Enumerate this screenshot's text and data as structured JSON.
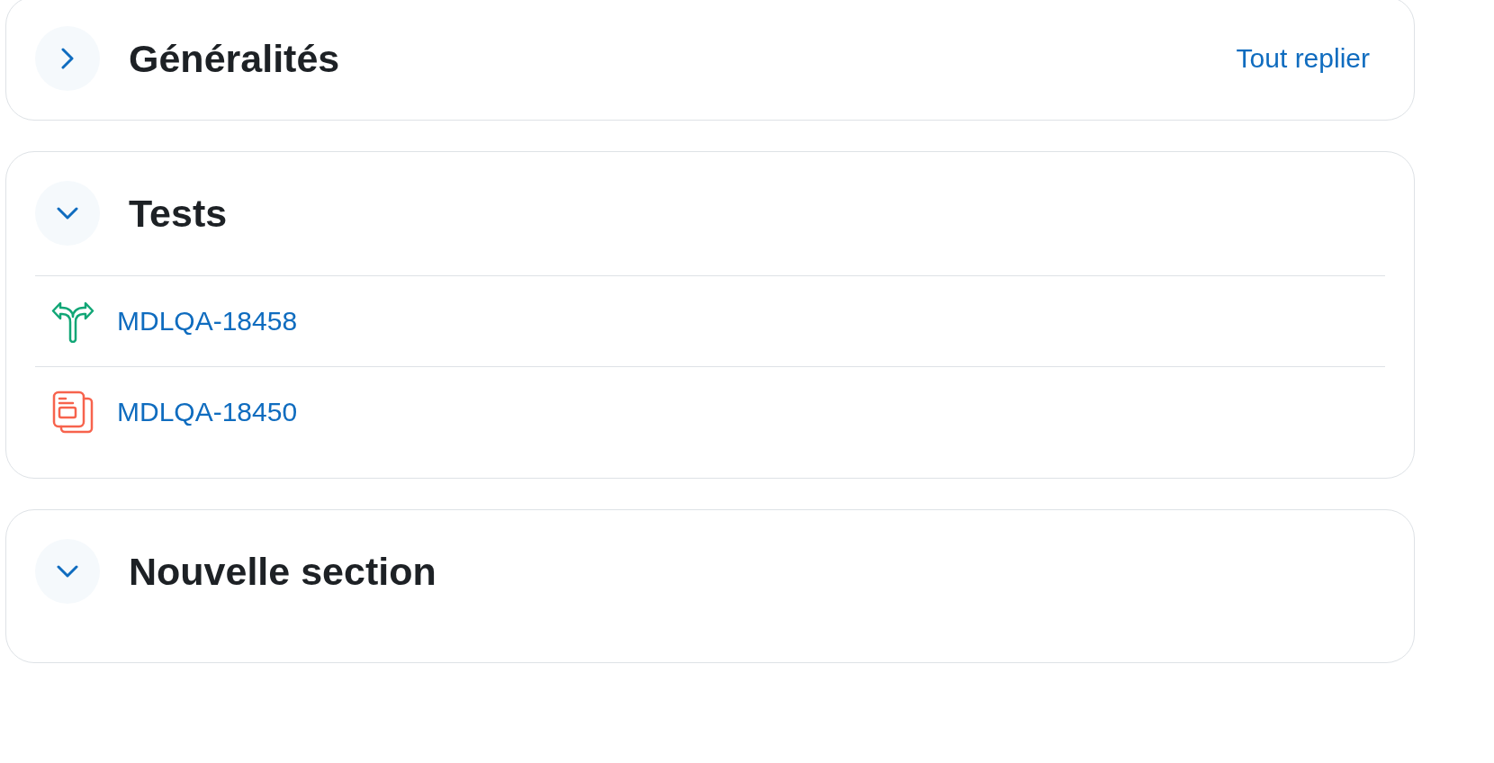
{
  "sections": [
    {
      "title": "Généralités",
      "expanded": false,
      "action": "Tout replier"
    },
    {
      "title": "Tests",
      "expanded": true,
      "items": [
        {
          "kind": "fork",
          "label": "MDLQA-18458"
        },
        {
          "kind": "pages",
          "label": "MDLQA-18450"
        }
      ]
    },
    {
      "title": "Nouvelle section",
      "expanded": true
    }
  ]
}
